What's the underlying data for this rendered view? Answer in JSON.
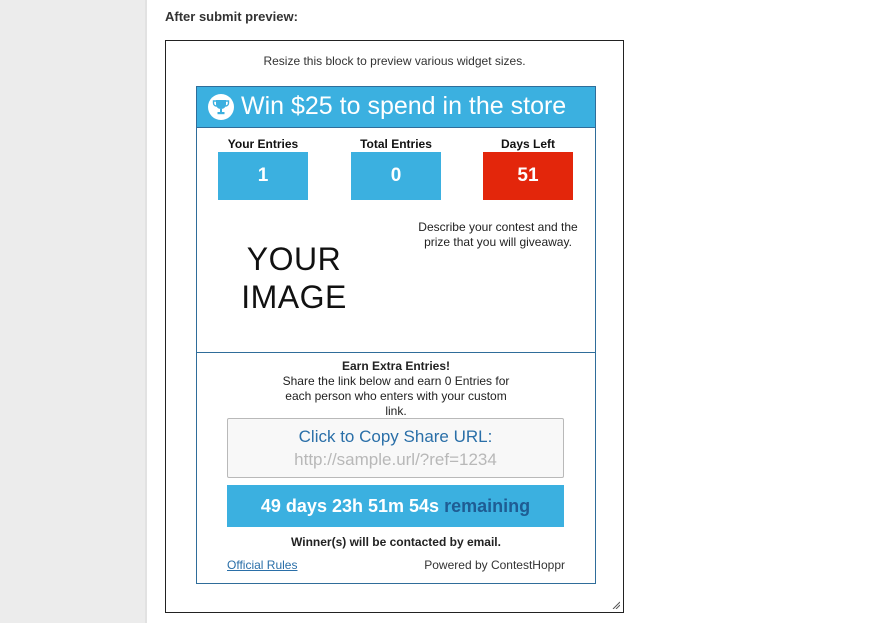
{
  "page": {
    "section_label": "After submit preview:"
  },
  "preview": {
    "hint": "Resize this block to preview various widget sizes."
  },
  "widget": {
    "title": "Win $25 to spend in the store",
    "icon": "trophy-icon",
    "accent_color": "#3bb0e0",
    "alert_color": "#e3260b",
    "stats": [
      {
        "label": "Your Entries",
        "value": "1"
      },
      {
        "label": "Total Entries",
        "value": "0"
      },
      {
        "label": "Days Left",
        "value": "51"
      }
    ],
    "image_placeholder_line1": "YOUR",
    "image_placeholder_line2": "IMAGE",
    "description": "Describe your contest and the prize that you will giveaway.",
    "earn_title": "Earn Extra Entries!",
    "earn_text": "Share the link below and earn 0 Entries for each person who enters with your custom link.",
    "copy_label": "Click to Copy Share URL:",
    "share_url": "http://sample.url/?ref=1234",
    "countdown_time": "49 days 23h 51m 54s",
    "countdown_suffix": "remaining",
    "winners_text": "Winner(s) will be contacted by email.",
    "rules_link": "Official Rules",
    "powered_by": "Powered by ContestHoppr"
  }
}
